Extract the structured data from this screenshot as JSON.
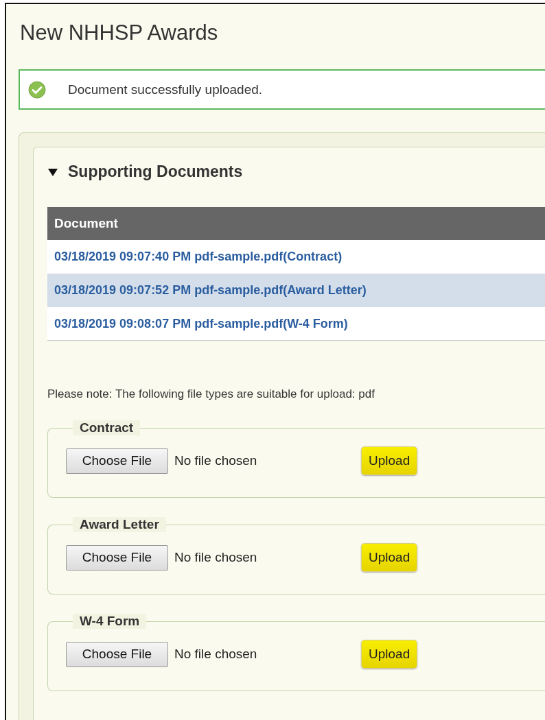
{
  "page": {
    "title": "New NHHSP Awards"
  },
  "alert": {
    "message": "Document successfully uploaded."
  },
  "section": {
    "title": "Supporting Documents",
    "expanded": true
  },
  "table": {
    "columns": [
      "Document"
    ],
    "rows": [
      {
        "document": "03/18/2019 09:07:40 PM pdf-sample.pdf(Contract)",
        "selected": false
      },
      {
        "document": "03/18/2019 09:07:52 PM pdf-sample.pdf(Award Letter)",
        "selected": true
      },
      {
        "document": "03/18/2019 09:08:07 PM pdf-sample.pdf(W-4 Form)",
        "selected": false
      }
    ]
  },
  "note": "Please note: The following file types are suitable for upload: pdf",
  "uploads": [
    {
      "legend": "Contract",
      "choose_label": "Choose File",
      "file_status": "No file chosen",
      "button": "Upload"
    },
    {
      "legend": "Award Letter",
      "choose_label": "Choose File",
      "file_status": "No file chosen",
      "button": "Upload"
    },
    {
      "legend": "W-4 Form",
      "choose_label": "Choose File",
      "file_status": "No file chosen",
      "button": "Upload"
    }
  ]
}
